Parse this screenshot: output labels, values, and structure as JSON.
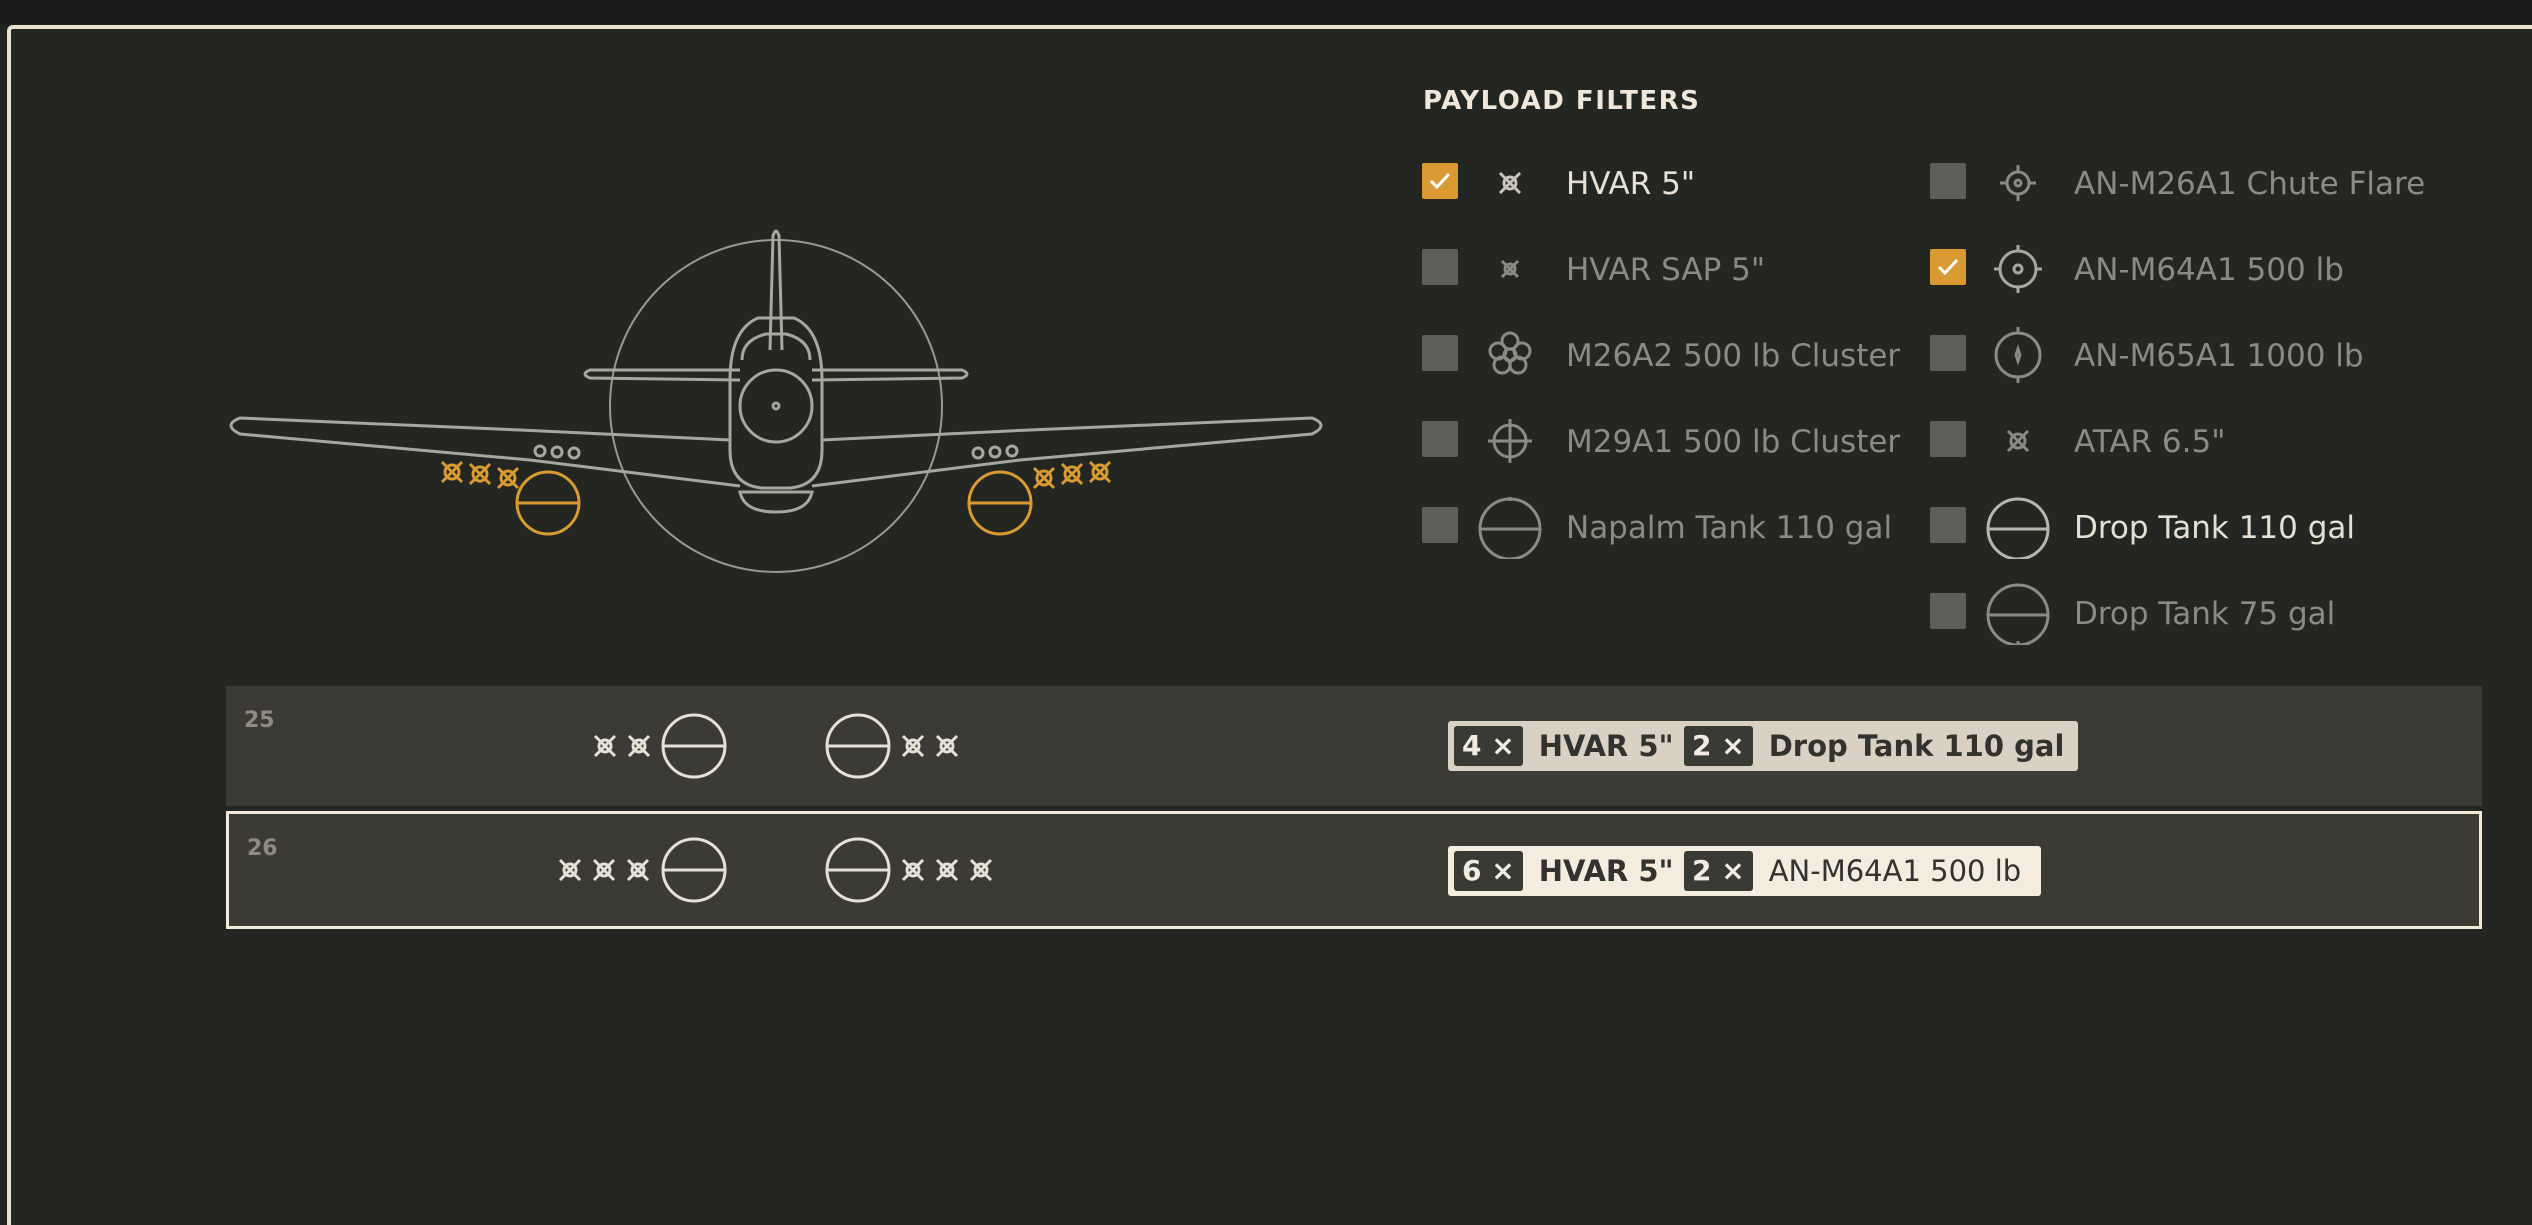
{
  "filters": {
    "title": "PAYLOAD FILTERS",
    "left": [
      {
        "label": "HVAR 5\"",
        "checked": true,
        "icon": "rocket-icon"
      },
      {
        "label": "HVAR SAP 5\"",
        "checked": false,
        "icon": "rocket-small-icon"
      },
      {
        "label": "M26A2 500 lb Cluster",
        "checked": false,
        "icon": "cluster-bomb-icon"
      },
      {
        "label": "M29A1 500 lb Cluster",
        "checked": false,
        "icon": "crosshair-bomb-icon"
      },
      {
        "label": "Napalm Tank 110 gal",
        "checked": false,
        "icon": "napalm-tank-icon"
      }
    ],
    "right": [
      {
        "label": "AN-M26A1 Chute Flare",
        "checked": false,
        "icon": "flare-icon"
      },
      {
        "label": "AN-M64A1 500 lb",
        "checked": true,
        "icon": "bomb-500-icon"
      },
      {
        "label": "AN-M65A1 1000 lb",
        "checked": false,
        "icon": "bomb-1000-icon"
      },
      {
        "label": "ATAR 6.5\"",
        "checked": false,
        "icon": "atar-rocket-icon"
      },
      {
        "label": "Drop Tank 110 gal",
        "checked": false,
        "icon": "drop-tank-icon"
      },
      {
        "label": "Drop Tank 75 gal",
        "checked": false,
        "icon": "drop-tank-small-icon"
      }
    ]
  },
  "accent_color": "#d99a33",
  "loadouts": [
    {
      "number": "25",
      "selected": false,
      "chips": [
        {
          "count": "4 ×",
          "name": "HVAR 5\""
        },
        {
          "count": "2 ×",
          "name": "Drop Tank 110 gal"
        }
      ]
    },
    {
      "number": "26",
      "selected": true,
      "chips": [
        {
          "count": "6 ×",
          "name": "HVAR 5\""
        },
        {
          "count": "2 ×",
          "name": "AN-M64A1 500 lb"
        }
      ]
    }
  ]
}
